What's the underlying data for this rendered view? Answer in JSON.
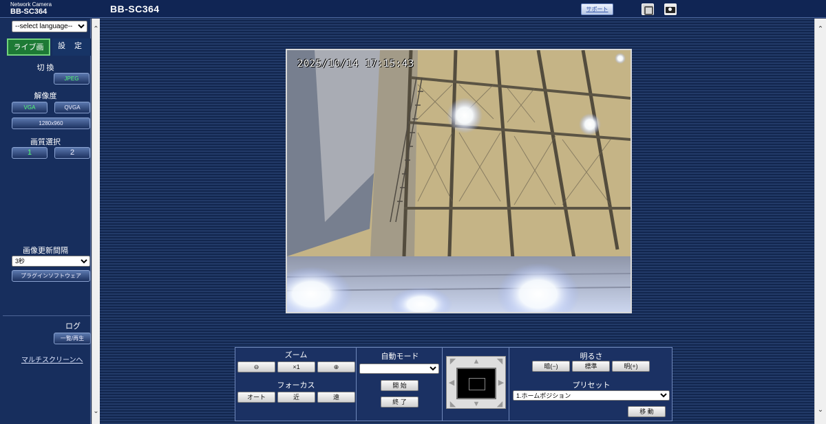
{
  "header": {
    "brand_line1": "Network Camera",
    "brand_line2": "BB-SC364",
    "title": "BB-SC364",
    "support_label": "サポート",
    "icons": [
      "monitor-icon",
      "camera-icon"
    ]
  },
  "sidebar": {
    "language_select": "--select language--",
    "tab_live": "ライブ画",
    "tab_settings": "設 定",
    "switch_label": "切 換",
    "jpeg_button": "JPEG",
    "resolution_label": "解像度",
    "vga_button": "VGA",
    "qvga_button": "QVGA",
    "hd_button": "1280x960",
    "quality_label": "画質選択",
    "quality_1": "1",
    "quality_2": "2",
    "refresh_label": "画像更新間隔",
    "refresh_value": "3秒",
    "plugin_button": "プラグインソフトウェア",
    "log_label": "ログ",
    "log_button": "一覧/再生",
    "multi_screen_link": "マルチスクリーンへ"
  },
  "video": {
    "timestamp": "2025/10/14  17:15:43"
  },
  "controls": {
    "zoom_label": "ズーム",
    "zoom_one": "×1",
    "focus_label": "フォーカス",
    "focus_auto": "オート",
    "focus_near": "近",
    "focus_far": "遠",
    "auto_mode_label": "自動モード",
    "auto_mode_value": "",
    "start_button": "開 始",
    "end_button": "終 了",
    "brightness_label": "明るさ",
    "dark_button": "暗(−)",
    "standard_button": "標準",
    "bright_button": "明(+)",
    "preset_label": "プリセット",
    "preset_value": "1.ホームポジション",
    "move_button": "移 動"
  }
}
